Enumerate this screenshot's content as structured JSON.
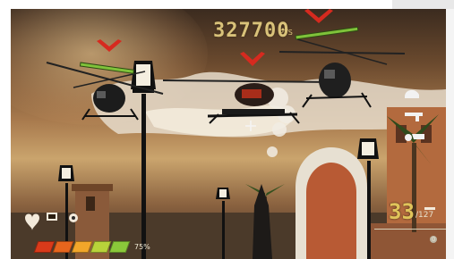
{
  "hud": {
    "score": "327700",
    "score_unit": "PTS",
    "ammo_clip": "33",
    "ammo_reserve": "/127",
    "health_percent": "75%",
    "health_level": 0.75,
    "ammo_sub_value": "0"
  },
  "colors": {
    "target_marker": "#d62a1f",
    "health_bar_bar": "#7fc23a",
    "score_text": "#d9c27a",
    "ammo_text": "#e0c45a",
    "health_segments": [
      "#d93a1a",
      "#e6651d",
      "#f2a62a",
      "#b8d33a",
      "#8ac83a"
    ]
  },
  "icons": {
    "heart": "heart-icon",
    "grenade": "grenade-icon",
    "ammo_box": "ammo-box-icon",
    "helmet": "helmet-icon",
    "weapon": "weapon-icon",
    "handgun": "handgun-icon",
    "crosshair": "crosshair-icon"
  }
}
